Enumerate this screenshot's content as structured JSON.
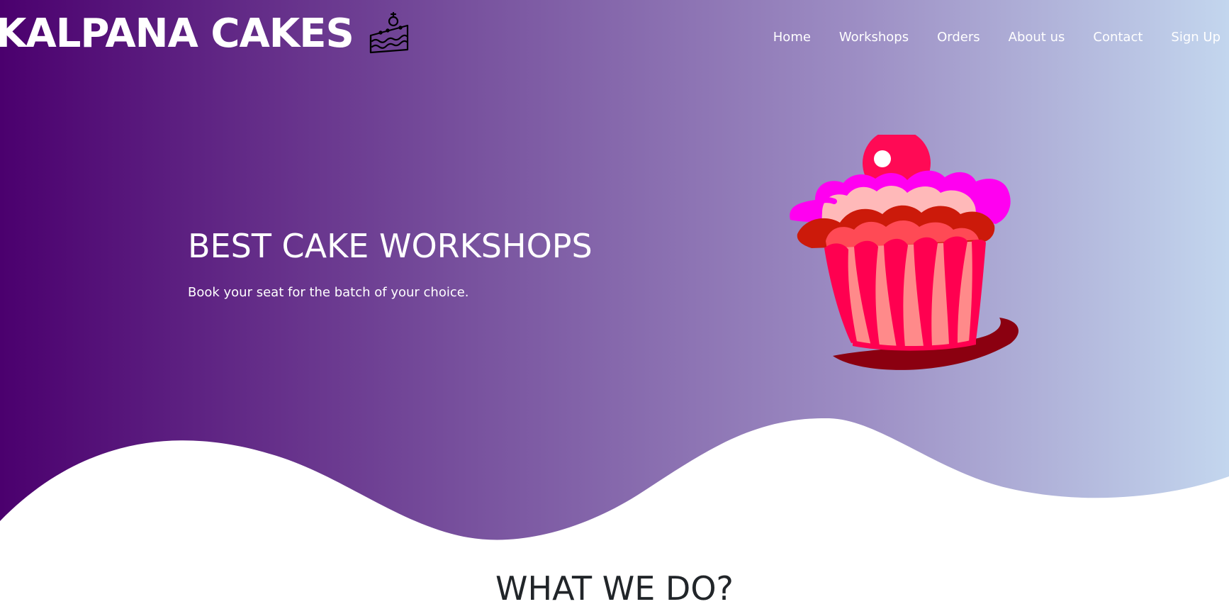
{
  "brand": {
    "name": "KALPANA CAKES",
    "icon": "cake-slice-icon"
  },
  "nav": {
    "items": [
      {
        "label": "Home"
      },
      {
        "label": "Workshops"
      },
      {
        "label": "Orders"
      },
      {
        "label": "About us"
      },
      {
        "label": "Contact"
      },
      {
        "label": "Sign Up"
      }
    ]
  },
  "hero": {
    "title": "BEST CAKE WORKSHOPS",
    "subtitle": "Book your seat for the batch of your choice.",
    "image": "cupcake-illustration",
    "gradient": [
      "#4b006e",
      "#7a55a0",
      "#9d8ec4",
      "#c3d6ee"
    ]
  },
  "section": {
    "heading": "WHAT WE DO?"
  }
}
